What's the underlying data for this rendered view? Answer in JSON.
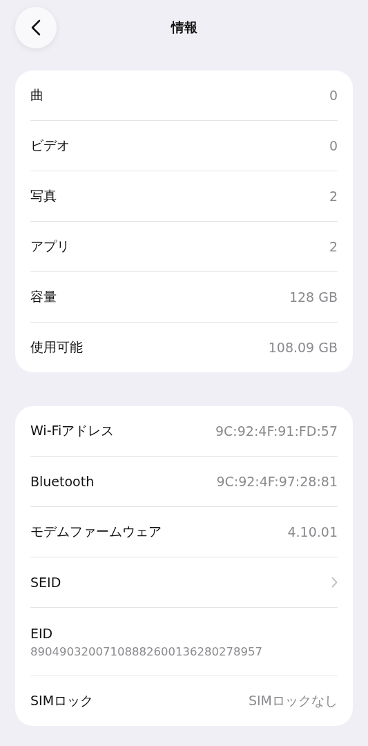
{
  "header": {
    "title": "情報"
  },
  "sections": [
    {
      "rows": [
        {
          "kind": "value",
          "label": "曲",
          "value": "0"
        },
        {
          "kind": "value",
          "label": "ビデオ",
          "value": "0"
        },
        {
          "kind": "value",
          "label": "写真",
          "value": "2"
        },
        {
          "kind": "value",
          "label": "アプリ",
          "value": "2"
        },
        {
          "kind": "value",
          "label": "容量",
          "value": "128 GB"
        },
        {
          "kind": "value",
          "label": "使用可能",
          "value": "108.09 GB"
        }
      ]
    },
    {
      "rows": [
        {
          "kind": "value",
          "label": "Wi-Fiアドレス",
          "value": "9C:92:4F:91:FD:57"
        },
        {
          "kind": "value",
          "label": "Bluetooth",
          "value": "9C:92:4F:97:28:81"
        },
        {
          "kind": "value",
          "label": "モデムファームウェア",
          "value": "4.10.01"
        },
        {
          "kind": "link",
          "label": "SEID"
        },
        {
          "kind": "stacked",
          "label": "EID",
          "value": "89049032007108882600136280278957"
        },
        {
          "kind": "value",
          "label": "SIMロック",
          "value": "SIMロックなし"
        }
      ]
    }
  ]
}
